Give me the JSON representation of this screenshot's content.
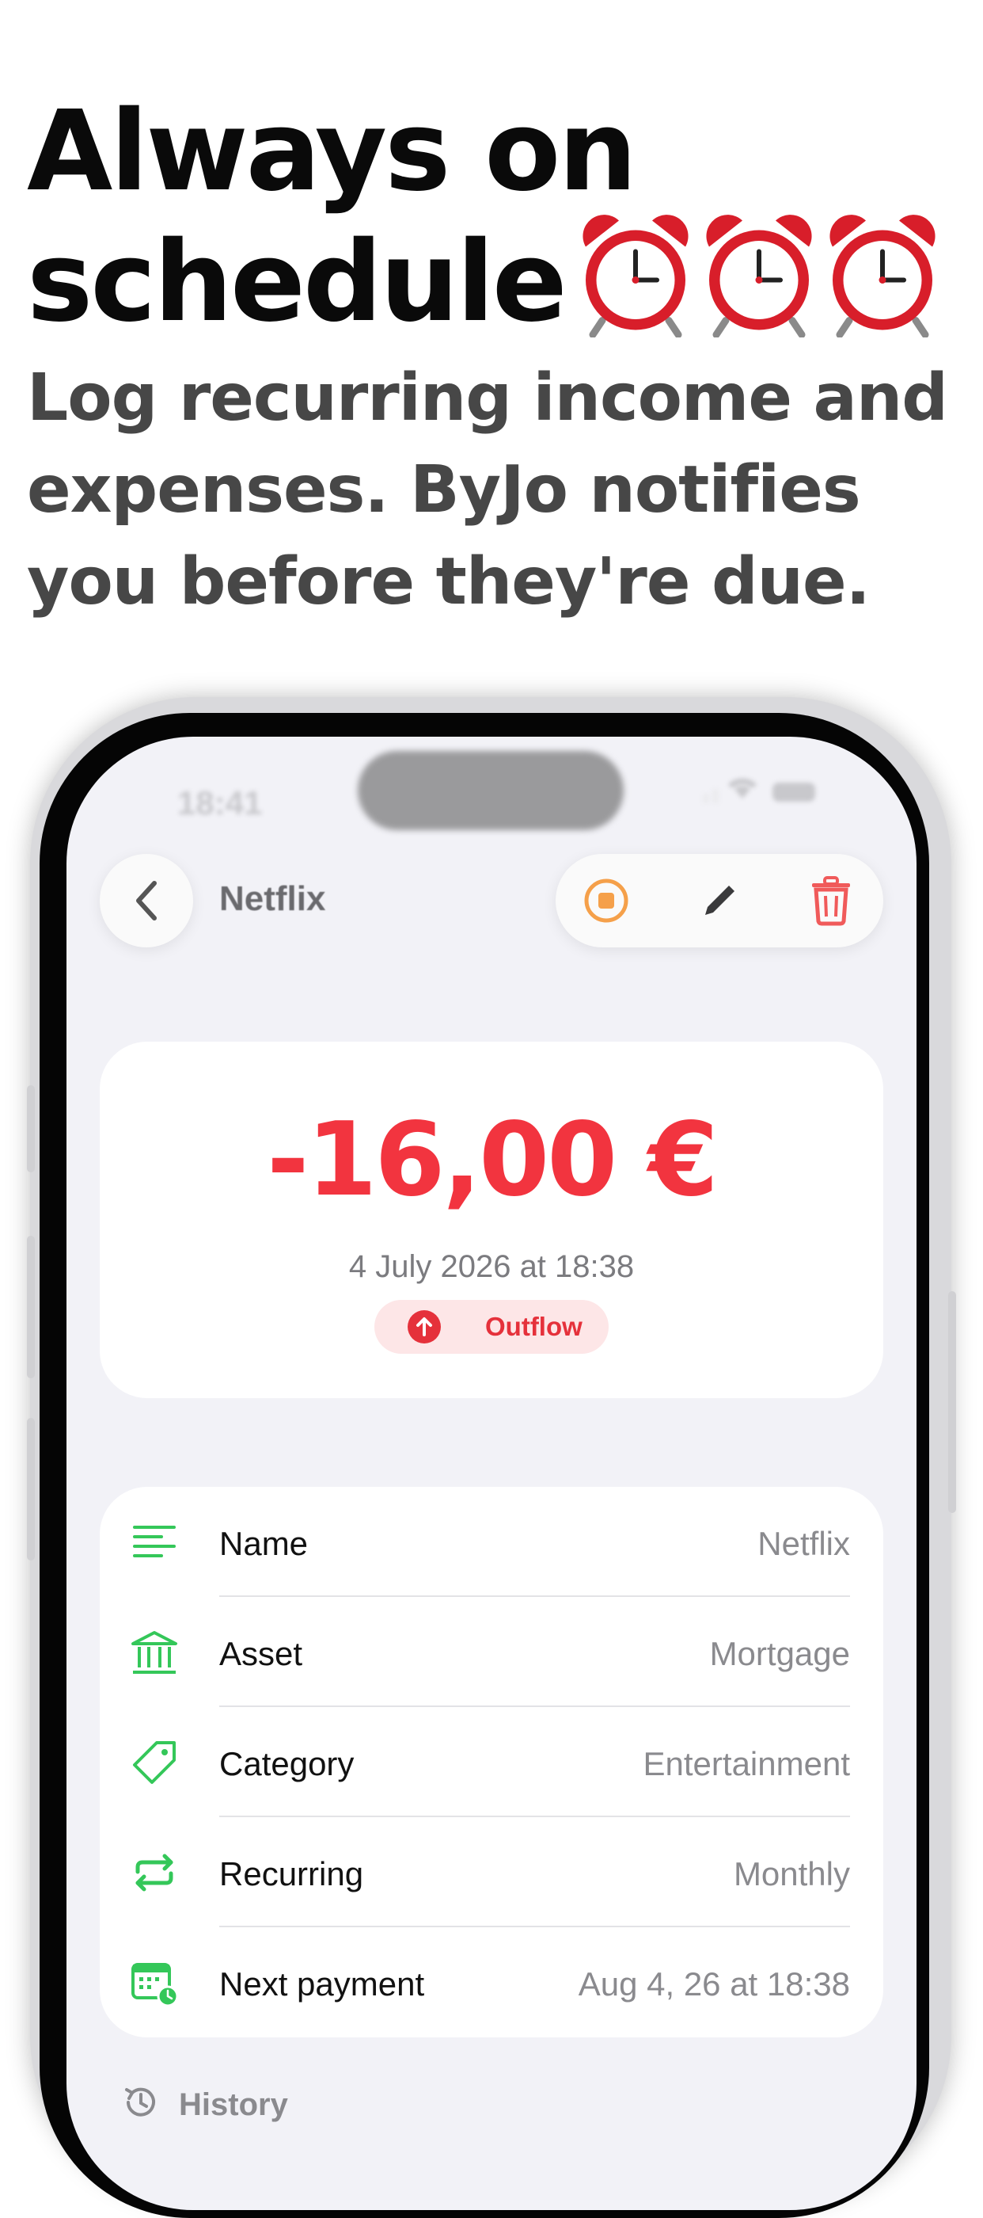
{
  "headline": {
    "line1": "Always on",
    "line2": "schedule",
    "emoji_icons": [
      "alarm-clock-icon",
      "alarm-clock-icon",
      "alarm-clock-icon"
    ]
  },
  "subheadline": "Log recurring income and expenses. ByJo notifies you before they're due.",
  "status_bar": {
    "time": "18:41"
  },
  "nav": {
    "title": "Netflix",
    "back_icon": "chevron-left-icon",
    "actions": [
      "stop-icon",
      "pencil-icon",
      "trash-icon"
    ]
  },
  "transaction": {
    "amount": "-16,00 €",
    "date": "4 July 2026 at 18:38",
    "flow_label": "Outflow",
    "flow_icon": "arrow-up-circle-icon"
  },
  "details": [
    {
      "label": "Name",
      "value": "Netflix",
      "icon": "text-lines-icon"
    },
    {
      "label": "Asset",
      "value": "Mortgage",
      "icon": "bank-icon"
    },
    {
      "label": "Category",
      "value": "Entertainment",
      "icon": "tag-icon"
    },
    {
      "label": "Recurring",
      "value": "Monthly",
      "icon": "repeat-icon"
    },
    {
      "label": "Next payment",
      "value": "Aug 4, 26 at 18:38",
      "icon": "calendar-clock-icon"
    }
  ],
  "history_label": "History",
  "colors": {
    "accent_green": "#34c759",
    "outflow_red": "#f2343f",
    "stop_orange": "#f5a04a",
    "screen_bg": "#f2f2f7"
  }
}
